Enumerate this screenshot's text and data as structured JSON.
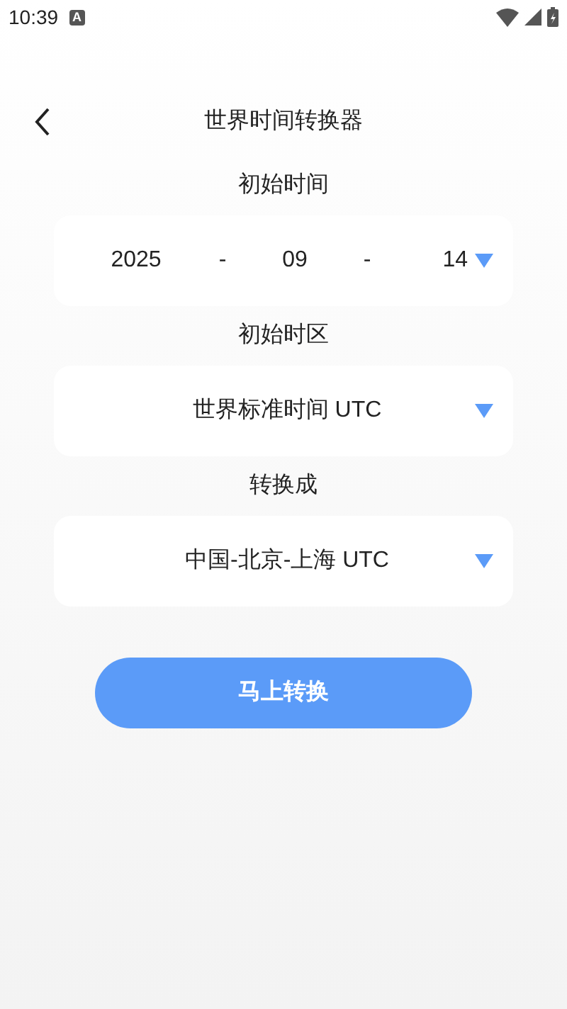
{
  "status_bar": {
    "time": "10:39",
    "notification": "A"
  },
  "header": {
    "title": "世界时间转换器"
  },
  "sections": [
    {
      "kind": "date",
      "label": "初始时间",
      "parts": [
        "2025",
        "-",
        "09",
        "-",
        "14"
      ]
    },
    {
      "kind": "select",
      "label": "初始时区",
      "value": "世界标准时间 UTC"
    },
    {
      "kind": "select",
      "label": "转换成",
      "value": "中国-北京-上海 UTC"
    }
  ],
  "button": {
    "label": "马上转换"
  }
}
